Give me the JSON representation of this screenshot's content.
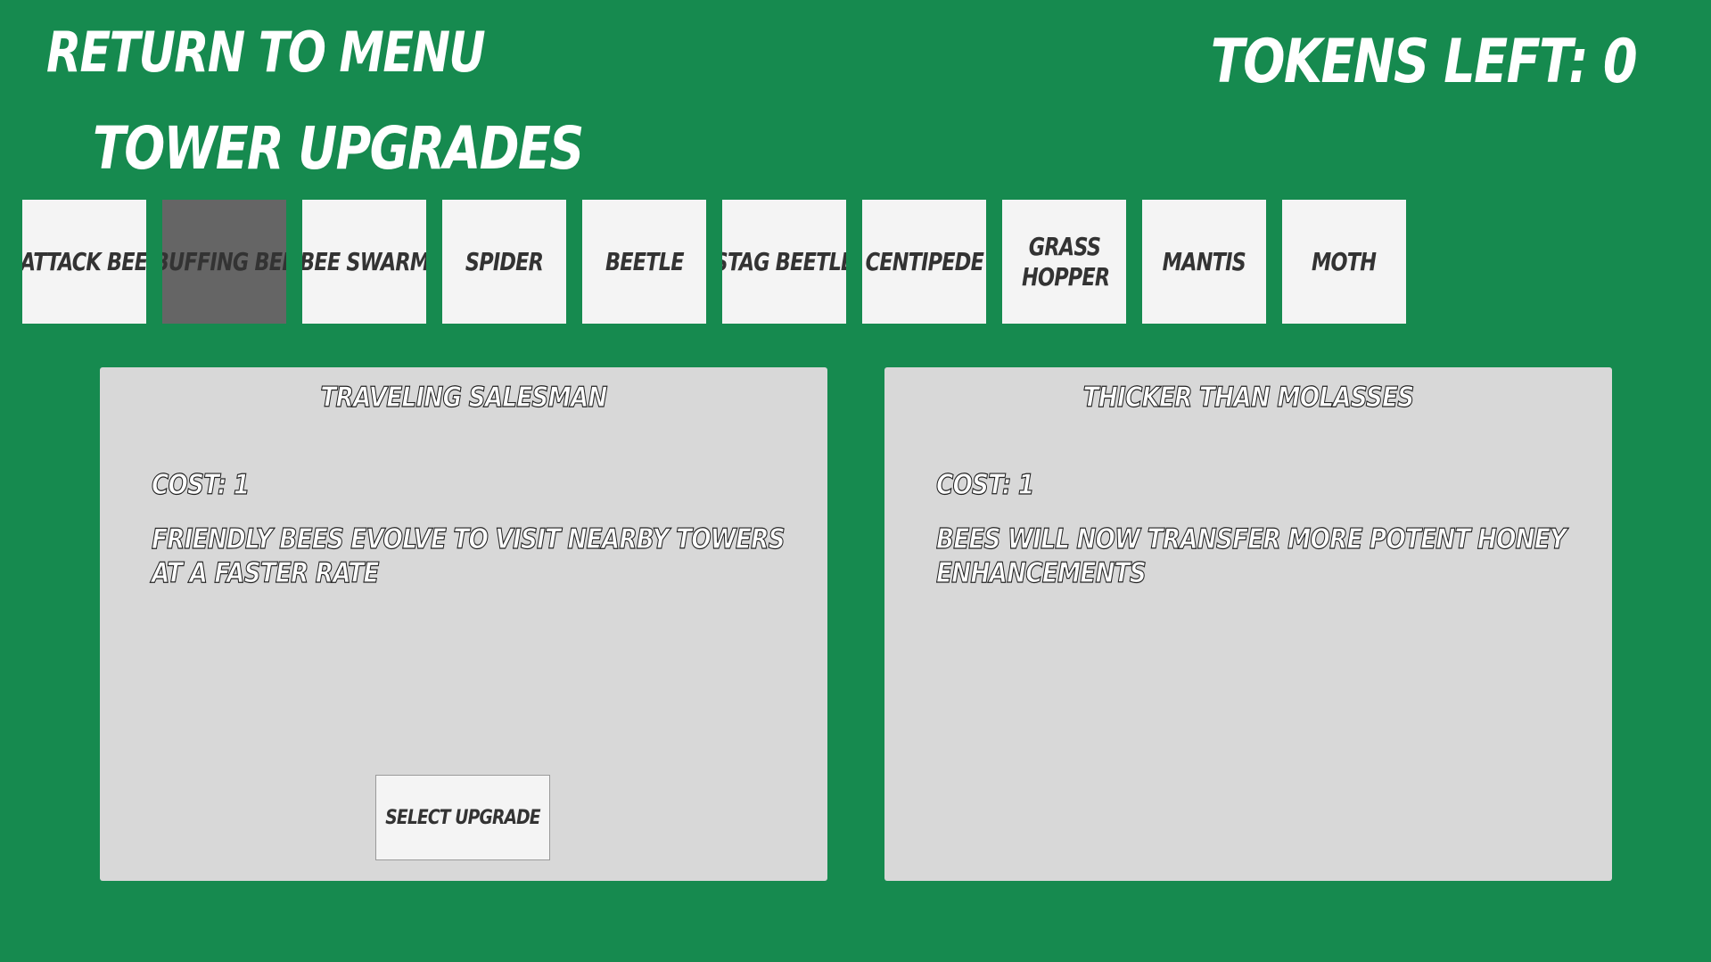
{
  "header": {
    "return_label": "Return to Menu",
    "tokens_label": "Tokens Left: 0",
    "section_title": "Tower Upgrades"
  },
  "towers": [
    {
      "label": "Attack Bee",
      "selected": false
    },
    {
      "label": "Buffing Bee",
      "selected": true
    },
    {
      "label": "Bee Swarm",
      "selected": false
    },
    {
      "label": "Spider",
      "selected": false
    },
    {
      "label": "Beetle",
      "selected": false
    },
    {
      "label": "Stag Beetle",
      "selected": false
    },
    {
      "label": "Centipede",
      "selected": false
    },
    {
      "label": "Grass Hopper",
      "selected": false
    },
    {
      "label": "Mantis",
      "selected": false
    },
    {
      "label": "Moth",
      "selected": false
    }
  ],
  "upgrades": [
    {
      "name": "Traveling Salesman",
      "cost": "Cost: 1",
      "description": "Friendly bees evolve to visit nearby towers at a faster rate",
      "button_label": "Select Upgrade"
    },
    {
      "name": "Thicker than Molasses",
      "cost": "Cost: 1",
      "description": "Bees will now transfer more potent honey enhancements"
    }
  ],
  "colors": {
    "background": "#168a4f",
    "tab": "#f4f4f4",
    "tab_selected": "#656565",
    "panel": "#d8d8d8"
  }
}
